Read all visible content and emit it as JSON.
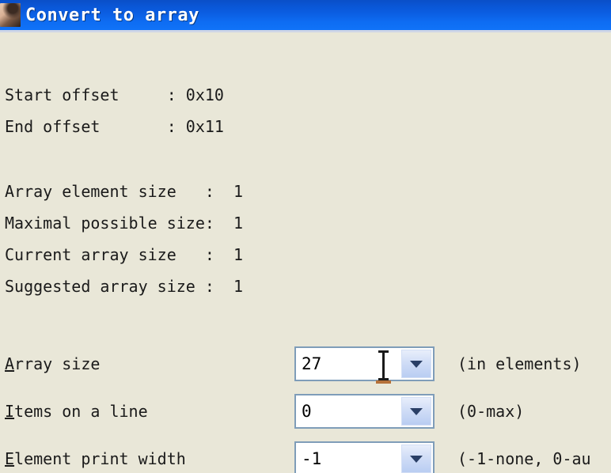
{
  "window": {
    "title": "Convert to array",
    "icon": "app-icon",
    "titlebar_color": "#0b5ee2",
    "background_color": "#e9e7d8"
  },
  "info": {
    "offsets": [
      {
        "label": "Start offset",
        "separator": ":",
        "value": "0x10"
      },
      {
        "label": "End offset",
        "separator": ":",
        "value": "0x11"
      }
    ],
    "sizes": [
      {
        "label": "Array element size",
        "separator": ":",
        "value": "1"
      },
      {
        "label": "Maximal possible size",
        "separator": ":",
        "value": "1"
      },
      {
        "label": "Current array size",
        "separator": ":",
        "value": "1"
      },
      {
        "label": "Suggested array size",
        "separator": ":",
        "value": "1"
      }
    ],
    "lines": [
      "Start offset     : 0x10",
      "End offset       : 0x11",
      "Array element size   :  1",
      "Maximal possible size:  1",
      "Current array size   :  1",
      "Suggested array size :  1"
    ]
  },
  "fields": [
    {
      "label_accel": "A",
      "label_rest": "rray size",
      "value": "27",
      "hint": "(in elements)",
      "dropdown_icon": "chevron-down-icon"
    },
    {
      "label_accel": "I",
      "label_rest": "tems on a line",
      "value": "0",
      "hint": "(0-max)",
      "dropdown_icon": "chevron-down-icon"
    },
    {
      "label_accel": "E",
      "label_rest": "lement print width",
      "value": "-1",
      "hint": "(-1-none, 0-au",
      "dropdown_icon": "chevron-down-icon"
    }
  ]
}
